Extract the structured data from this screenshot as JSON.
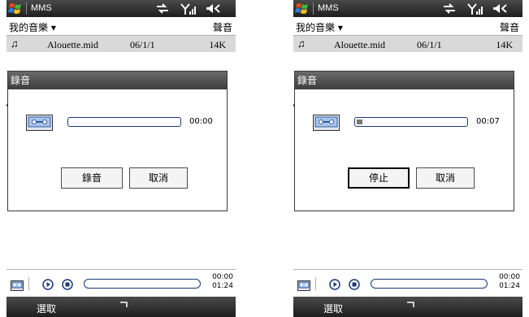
{
  "phones": [
    {
      "title": "MMS",
      "menu": {
        "left": "我的音樂 ▾",
        "right": "聲音"
      },
      "file_row": {
        "name": "Alouette.mid",
        "date": "06/1/1",
        "size": "14K"
      },
      "dialog": {
        "title": "錄音",
        "elapsed": "00:00",
        "progress": 0.0,
        "primary_button": "錄音",
        "cancel_button": "取消",
        "primary_focused": false
      },
      "player": {
        "position": "00:00",
        "duration": "01:24"
      },
      "softkey_left": "選取"
    },
    {
      "title": "MMS",
      "menu": {
        "left": "我的音樂 ▾",
        "right": "聲音"
      },
      "file_row": {
        "name": "Alouette.mid",
        "date": "06/1/1",
        "size": "14K"
      },
      "dialog": {
        "title": "錄音",
        "elapsed": "00:07",
        "progress": 0.05,
        "primary_button": "停止",
        "cancel_button": "取消",
        "primary_focused": true
      },
      "player": {
        "position": "00:00",
        "duration": "01:24"
      },
      "softkey_left": "選取"
    }
  ]
}
